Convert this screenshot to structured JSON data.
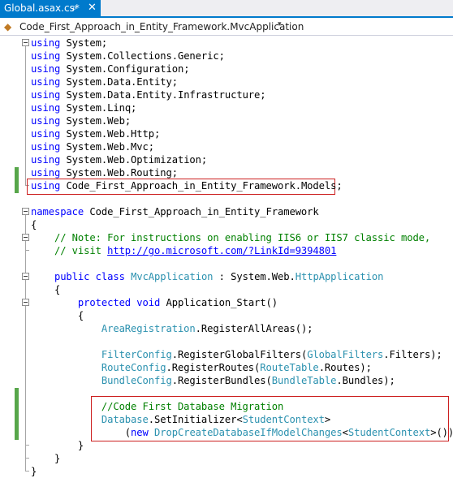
{
  "tab": {
    "title": "Global.asax.cs*",
    "pin_icon": "pin-icon",
    "close_icon": "close-icon"
  },
  "navbar": {
    "icon": "class-icon",
    "text": "Code_First_Approach_in_Entity_Framework.MvcApplication"
  },
  "editor": {
    "lines": [
      [
        [
          "kw",
          "using"
        ],
        [
          "p",
          " System;"
        ]
      ],
      [
        [
          "kw",
          "using"
        ],
        [
          "p",
          " System.Collections.Generic;"
        ]
      ],
      [
        [
          "kw",
          "using"
        ],
        [
          "p",
          " System.Configuration;"
        ]
      ],
      [
        [
          "kw",
          "using"
        ],
        [
          "p",
          " System.Data.Entity;"
        ]
      ],
      [
        [
          "kw",
          "using"
        ],
        [
          "p",
          " System.Data.Entity.Infrastructure;"
        ]
      ],
      [
        [
          "kw",
          "using"
        ],
        [
          "p",
          " System.Linq;"
        ]
      ],
      [
        [
          "kw",
          "using"
        ],
        [
          "p",
          " System.Web;"
        ]
      ],
      [
        [
          "kw",
          "using"
        ],
        [
          "p",
          " System.Web.Http;"
        ]
      ],
      [
        [
          "kw",
          "using"
        ],
        [
          "p",
          " System.Web.Mvc;"
        ]
      ],
      [
        [
          "kw",
          "using"
        ],
        [
          "p",
          " System.Web.Optimization;"
        ]
      ],
      [
        [
          "kw",
          "using"
        ],
        [
          "p",
          " System.Web.Routing;"
        ]
      ],
      [
        [
          "kw",
          "using"
        ],
        [
          "p",
          " Code_First_Approach_in_Entity_Framework.Models;"
        ]
      ],
      [],
      [
        [
          "kw",
          "namespace"
        ],
        [
          "p",
          " Code_First_Approach_in_Entity_Framework"
        ]
      ],
      [
        [
          "p",
          "{"
        ]
      ],
      [
        [
          "p",
          "    "
        ],
        [
          "cm",
          "// Note: For instructions on enabling IIS6 or IIS7 classic mode,"
        ]
      ],
      [
        [
          "p",
          "    "
        ],
        [
          "cm",
          "// visit "
        ],
        [
          "ln",
          "http://go.microsoft.com/?LinkId=9394801"
        ]
      ],
      [],
      [
        [
          "p",
          "    "
        ],
        [
          "kw",
          "public"
        ],
        [
          "p",
          " "
        ],
        [
          "kw",
          "class"
        ],
        [
          "p",
          " "
        ],
        [
          "ty",
          "MvcApplication"
        ],
        [
          "p",
          " : System.Web."
        ],
        [
          "ty",
          "HttpApplication"
        ]
      ],
      [
        [
          "p",
          "    {"
        ]
      ],
      [
        [
          "p",
          "        "
        ],
        [
          "kw",
          "protected"
        ],
        [
          "p",
          " "
        ],
        [
          "kw",
          "void"
        ],
        [
          "p",
          " Application_Start()"
        ]
      ],
      [
        [
          "p",
          "        {"
        ]
      ],
      [
        [
          "p",
          "            "
        ],
        [
          "ty",
          "AreaRegistration"
        ],
        [
          "p",
          ".RegisterAllAreas();"
        ]
      ],
      [],
      [
        [
          "p",
          "            "
        ],
        [
          "ty",
          "FilterConfig"
        ],
        [
          "p",
          ".RegisterGlobalFilters("
        ],
        [
          "ty",
          "GlobalFilters"
        ],
        [
          "p",
          ".Filters);"
        ]
      ],
      [
        [
          "p",
          "            "
        ],
        [
          "ty",
          "RouteConfig"
        ],
        [
          "p",
          ".RegisterRoutes("
        ],
        [
          "ty",
          "RouteTable"
        ],
        [
          "p",
          ".Routes);"
        ]
      ],
      [
        [
          "p",
          "            "
        ],
        [
          "ty",
          "BundleConfig"
        ],
        [
          "p",
          ".RegisterBundles("
        ],
        [
          "ty",
          "BundleTable"
        ],
        [
          "p",
          ".Bundles);"
        ]
      ],
      [],
      [
        [
          "p",
          "            "
        ],
        [
          "cm",
          "//Code First Database Migration"
        ]
      ],
      [
        [
          "p",
          "            "
        ],
        [
          "ty",
          "Database"
        ],
        [
          "p",
          ".SetInitializer<"
        ],
        [
          "ty",
          "StudentContext"
        ],
        [
          "p",
          ">"
        ]
      ],
      [
        [
          "p",
          "                ("
        ],
        [
          "kw",
          "new"
        ],
        [
          "p",
          " "
        ],
        [
          "ty",
          "DropCreateDatabaseIfModelChanges"
        ],
        [
          "p",
          "<"
        ],
        [
          "ty",
          "StudentContext"
        ],
        [
          "p",
          ">());"
        ]
      ],
      [
        [
          "p",
          "        }"
        ]
      ],
      [
        [
          "p",
          "    }"
        ]
      ],
      [
        [
          "p",
          "}"
        ]
      ]
    ]
  }
}
